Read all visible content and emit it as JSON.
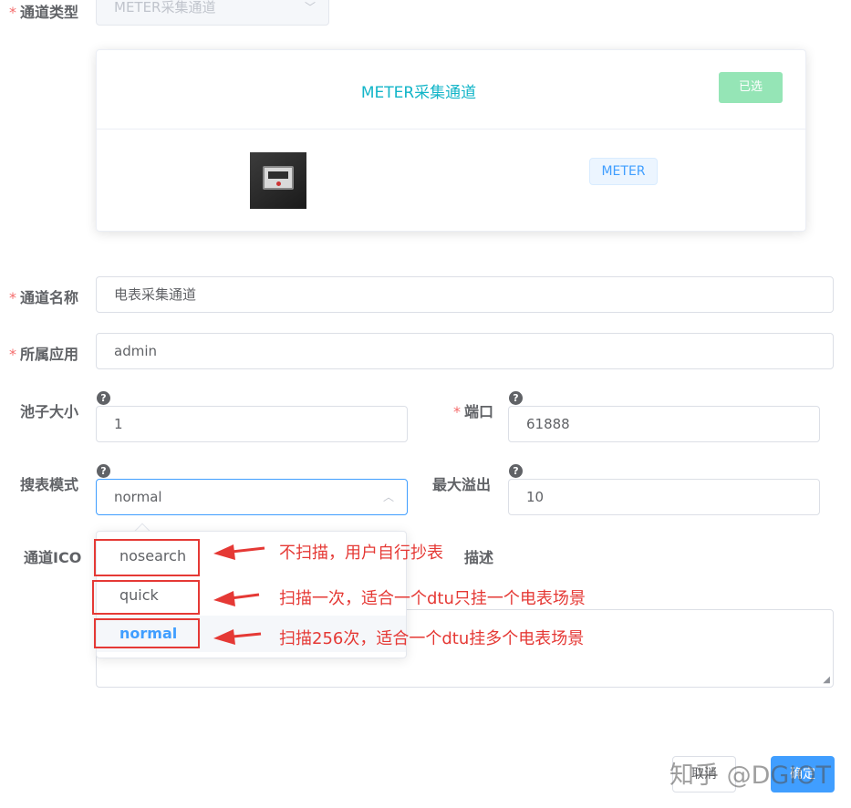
{
  "form": {
    "channel_type": {
      "label": "通道类型",
      "value": "METER采集通道"
    },
    "card": {
      "title": "METER采集通道",
      "selected_label": "已选",
      "tag": "METER"
    },
    "channel_name": {
      "label": "通道名称",
      "value": "电表采集通道"
    },
    "app": {
      "label": "所属应用",
      "value": "admin"
    },
    "pool_size": {
      "label": "池子大小",
      "value": "1"
    },
    "port": {
      "label": "端口",
      "value": "61888"
    },
    "search_mode": {
      "label": "搜表模式",
      "value": "normal"
    },
    "max_overflow": {
      "label": "最大溢出",
      "value": "10"
    },
    "channel_icon": {
      "label": "通道ICO"
    },
    "description": {
      "label": "描述"
    }
  },
  "help_symbol": "?",
  "required_mark": "*",
  "dropdown": {
    "options": [
      "nosearch",
      "quick",
      "normal"
    ],
    "selected": "normal"
  },
  "annotations": [
    "不扫描，用户自行抄表",
    "扫描一次，适合一个dtu只挂一个电表场景",
    "扫描256次，适合一个dtu挂多个电表场景"
  ],
  "buttons": {
    "cancel": "取消",
    "ok": "确定"
  },
  "watermark": "知乎 @DGIOT",
  "colors": {
    "accent": "#409eff",
    "teal": "#13b5c8",
    "selected_green": "#95e5b6",
    "annotation_red": "#e53935",
    "required_red": "#f56c6c"
  }
}
